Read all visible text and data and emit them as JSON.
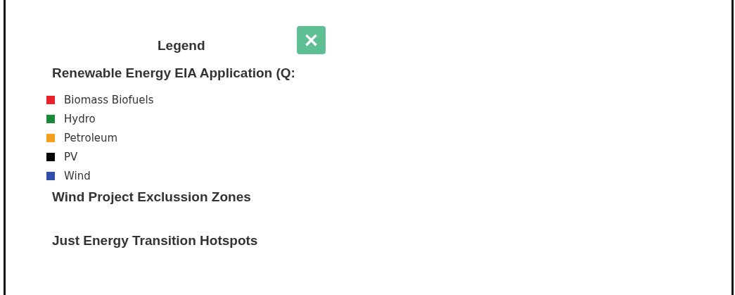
{
  "legend": {
    "title": "Legend",
    "close_button": {
      "label": "×"
    },
    "sections": [
      {
        "title": "Renewable Energy EIA Application (Q:",
        "items": [
          {
            "label": "Biomass Biofuels",
            "color": "#e8202a"
          },
          {
            "label": "Hydro",
            "color": "#1a8a3a"
          },
          {
            "label": "Petroleum",
            "color": "#f5a01e"
          },
          {
            "label": "PV",
            "color": "#000000"
          },
          {
            "label": "Wind",
            "color": "#2f4fa8"
          }
        ]
      },
      {
        "title": "Wind Project Exclussion Zones"
      },
      {
        "title": "Just Energy Transition Hotspots"
      }
    ]
  }
}
